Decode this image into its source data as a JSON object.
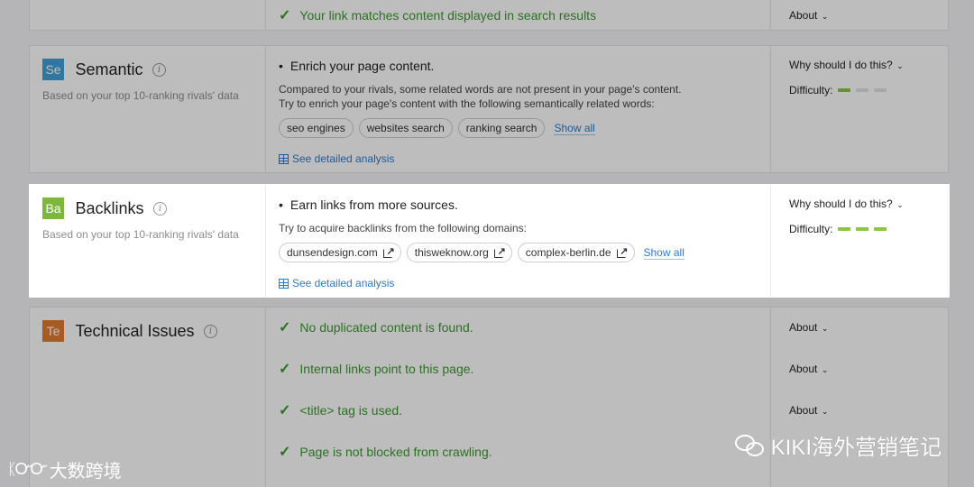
{
  "top_partial": {
    "text": "Your link matches content displayed in search results",
    "about_label": "About"
  },
  "semantic": {
    "badge": "Se",
    "title": "Semantic",
    "subtitle": "Based on your top 10-ranking rivals' data",
    "bullet": "Enrich your page content.",
    "desc_line1": "Compared to your rivals, some related words are not present in your page's content.",
    "desc_line2": "Try to enrich your page's content with the following semantically related words:",
    "tags": [
      "seo engines",
      "websites search",
      "ranking search"
    ],
    "show_all": "Show all",
    "analysis_link": "See detailed analysis",
    "why_label": "Why should I do this?",
    "difficulty_label": "Difficulty:",
    "difficulty_level": 1
  },
  "backlinks": {
    "badge": "Ba",
    "title": "Backlinks",
    "subtitle": "Based on your top 10-ranking rivals' data",
    "bullet": "Earn links from more sources.",
    "desc": "Try to acquire backlinks from the following domains:",
    "domains": [
      "dunsendesign.com",
      "thisweknow.org",
      "complex-berlin.de"
    ],
    "show_all": "Show all",
    "analysis_link": "See detailed analysis",
    "why_label": "Why should I do this?",
    "difficulty_label": "Difficulty:",
    "difficulty_level": 3
  },
  "technical": {
    "badge": "Te",
    "title": "Technical Issues",
    "checks": [
      "No duplicated content is found.",
      "Internal links point to this page.",
      "<title> tag is used.",
      "Page is not blocked from crawling."
    ],
    "about_label": "About"
  },
  "watermarks": {
    "right": "KIKI海外营销笔记",
    "left": "大数跨境"
  },
  "colors": {
    "accent_green": "#8ec63f",
    "link_blue": "#2a7bd0",
    "semantic_badge": "#43a0d6",
    "backlinks_badge": "#7cb83c",
    "technical_badge": "#e27a31"
  }
}
